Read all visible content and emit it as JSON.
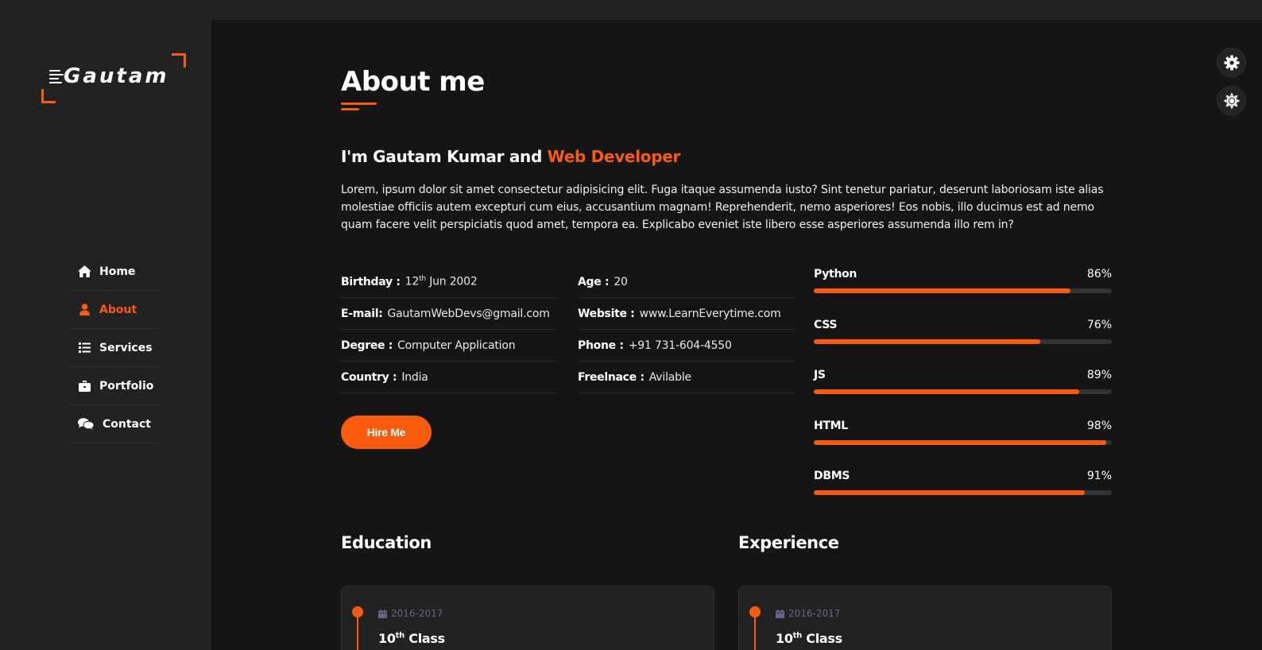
{
  "logo": {
    "text": "Gautam",
    "icon": "speed-lines-icon"
  },
  "nav": {
    "items": [
      {
        "label": "Home",
        "icon": "home-icon",
        "active": false
      },
      {
        "label": "About",
        "icon": "user-icon",
        "active": true
      },
      {
        "label": "Services",
        "icon": "list-icon",
        "active": false
      },
      {
        "label": "Portfolio",
        "icon": "briefcase-icon",
        "active": false
      },
      {
        "label": "Contact",
        "icon": "comments-icon",
        "active": false
      }
    ]
  },
  "page": {
    "title": "About me",
    "intro_prefix": "I'm Gautam Kumar and ",
    "intro_role": "Web Developer",
    "bio": "Lorem, ipsum dolor sit amet consectetur adipisicing elit. Fuga itaque assumenda iusto? Sint tenetur pariatur, deserunt laboriosam iste alias molestiae officiis autem excepturi cum eius, accusantium magnam! Reprehenderit, nemo asperiores! Eos nobis, illo ducimus est ad nemo quam facere velit perspiciatis quod amet, tempora ea. Explicabo eveniet iste libero esse asperiores assumenda illo rem in?"
  },
  "info": {
    "birthday": {
      "key": "Birthday :",
      "day": "12",
      "sup": "th",
      "rest": " Jun 2002"
    },
    "email": {
      "key": "E-mail:",
      "value": "GautamWebDevs@gmail.com"
    },
    "degree": {
      "key": "Degree :",
      "value": "Computer Application"
    },
    "country": {
      "key": "Country :",
      "value": "India"
    },
    "age": {
      "key": "Age :",
      "value": "20"
    },
    "website": {
      "key": "Website :",
      "value": "www.LearnEverytime.com"
    },
    "phone": {
      "key": "Phone :",
      "value": "+91 731-604-4550"
    },
    "freelance": {
      "key": "Freelnace :",
      "value": "Avilable"
    }
  },
  "hire_button": "Hire Me",
  "skills": [
    {
      "name": "Python",
      "percent_label": "86%",
      "value": 86
    },
    {
      "name": "CSS",
      "percent_label": "76%",
      "value": 76
    },
    {
      "name": "JS",
      "percent_label": "89%",
      "value": 89
    },
    {
      "name": "HTML",
      "percent_label": "98%",
      "value": 98
    },
    {
      "name": "DBMS",
      "percent_label": "91%",
      "value": 91
    }
  ],
  "education": {
    "title": "Education",
    "items": [
      {
        "date": "2016-2017",
        "num": "10",
        "sup": "th",
        "rest": " Class"
      }
    ]
  },
  "experience": {
    "title": "Experience",
    "items": [
      {
        "date": "2016-2017",
        "num": "10",
        "sup": "th",
        "rest": " Class"
      }
    ]
  },
  "float_buttons": [
    "gear-icon",
    "sun-icon"
  ],
  "colors": {
    "accent": "#fa5b0f",
    "background": "#151515",
    "sidebar": "#222223",
    "date_text": "#6b6488"
  }
}
